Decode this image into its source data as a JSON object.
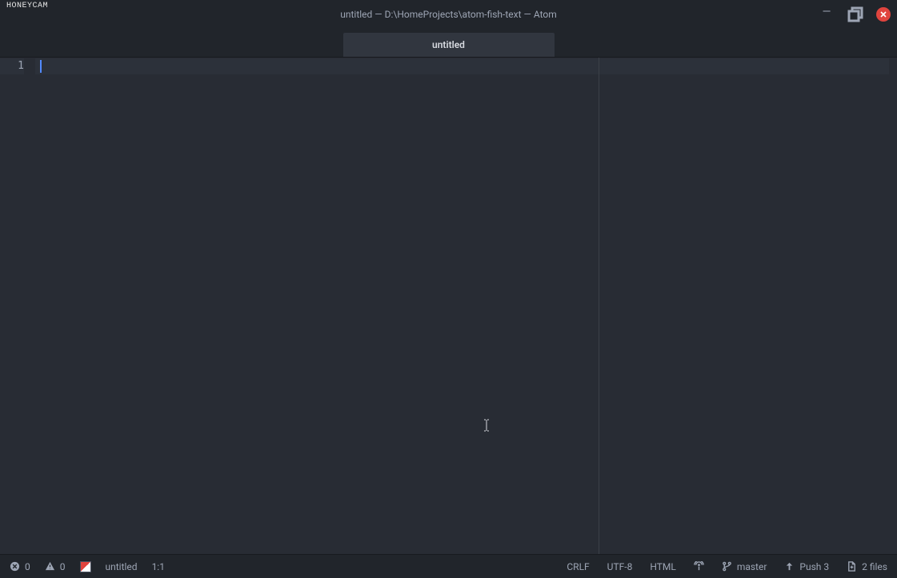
{
  "watermark": "HONEYCAM",
  "title_bar": {
    "title": "untitled — D:\\HomeProjects\\atom-fish-text — Atom"
  },
  "tabs": [
    {
      "label": "untitled",
      "active": true
    }
  ],
  "editor": {
    "line_numbers": [
      "1"
    ],
    "content": ""
  },
  "status_bar": {
    "errors": "0",
    "warnings": "0",
    "filename": "untitled",
    "cursor_position": "1:1",
    "line_ending": "CRLF",
    "encoding": "UTF-8",
    "grammar": "HTML",
    "branch": "master",
    "push": "Push 3",
    "files": "2 files"
  }
}
